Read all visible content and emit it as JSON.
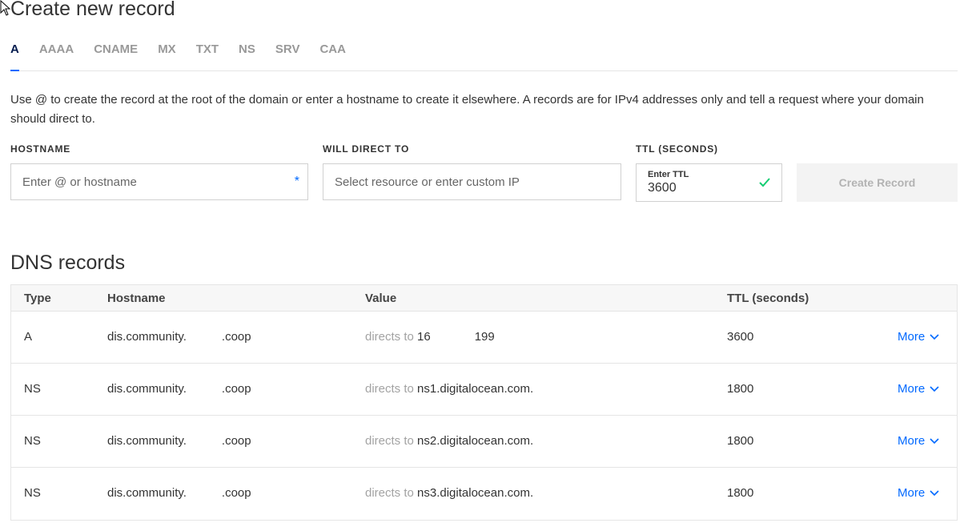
{
  "page": {
    "title": "Create new record",
    "tabs": [
      "A",
      "AAAA",
      "CNAME",
      "MX",
      "TXT",
      "NS",
      "SRV",
      "CAA"
    ],
    "active_tab": "A",
    "help_text": "Use @ to create the record at the root of the domain or enter a hostname to create it elsewhere. A records are for IPv4 addresses only and tell a request where your domain should direct to."
  },
  "form": {
    "hostname_label": "HOSTNAME",
    "hostname_placeholder": "Enter @ or hostname",
    "direct_label": "WILL DIRECT TO",
    "direct_placeholder": "Select resource or enter custom IP",
    "ttl_label": "TTL (SECONDS)",
    "ttl_mini_label": "Enter TTL",
    "ttl_value": "3600",
    "create_button": "Create Record"
  },
  "dns": {
    "title": "DNS records",
    "columns": [
      "Type",
      "Hostname",
      "Value",
      "TTL (seconds)"
    ],
    "directs_to_label": "directs to",
    "more_label": "More",
    "rows": [
      {
        "type": "A",
        "host_start": "dis.community.",
        "host_end": ".coop",
        "value_start": "16",
        "value_end": "199",
        "ttl": "3600"
      },
      {
        "type": "NS",
        "host_start": "dis.community.",
        "host_end": ".coop",
        "value_start": "ns1.digitalocean.com.",
        "value_end": "",
        "ttl": "1800"
      },
      {
        "type": "NS",
        "host_start": "dis.community.",
        "host_end": ".coop",
        "value_start": "ns2.digitalocean.com.",
        "value_end": "",
        "ttl": "1800"
      },
      {
        "type": "NS",
        "host_start": "dis.community.",
        "host_end": ".coop",
        "value_start": "ns3.digitalocean.com.",
        "value_end": "",
        "ttl": "1800"
      }
    ]
  },
  "colors": {
    "accent": "#0069ff",
    "success": "#15cd72",
    "muted_text": "#a3a3a3"
  },
  "icons": [
    "mouse-pointer-icon",
    "required-asterisk-icon",
    "checkmark-icon",
    "chevron-down-icon"
  ]
}
